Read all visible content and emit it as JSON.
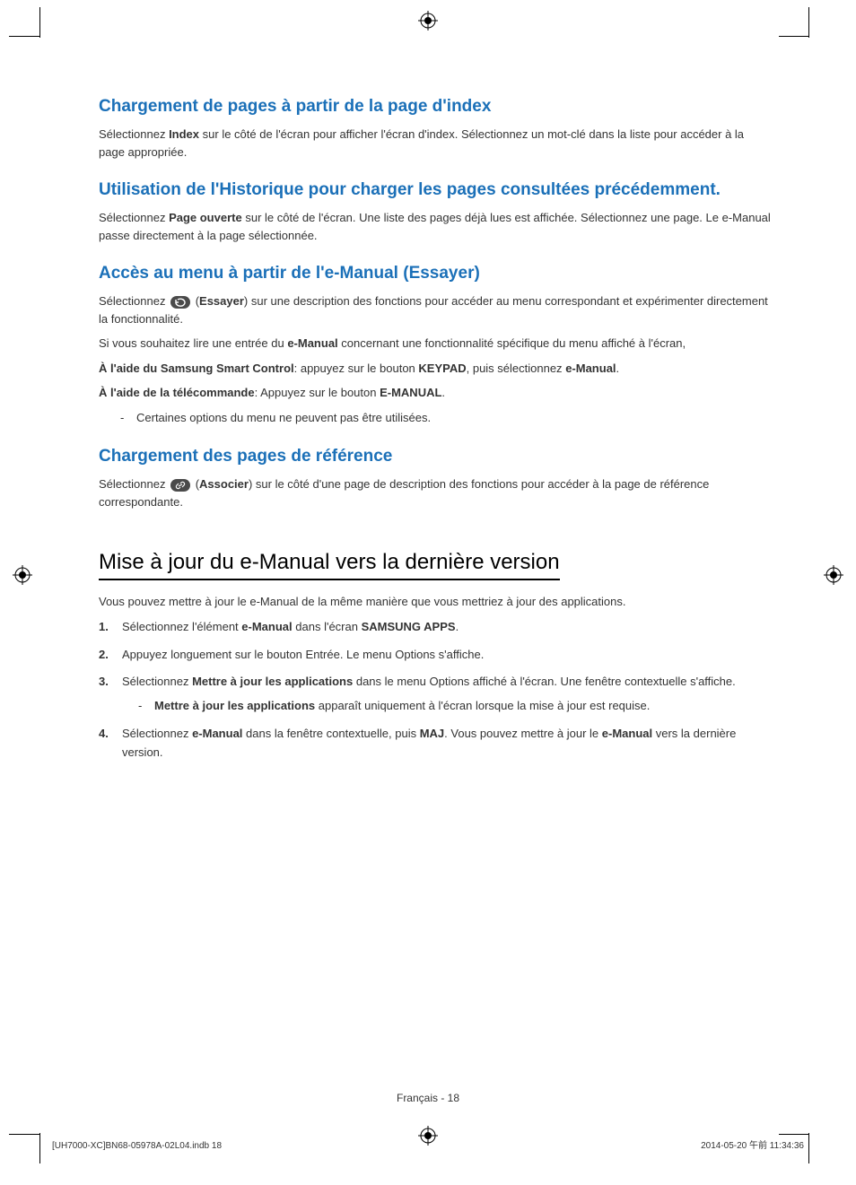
{
  "sections": [
    {
      "title": "Chargement de pages à partir de la page d'index",
      "p1a": "Sélectionnez ",
      "b1": "Index",
      "p1b": " sur le côté de l'écran pour afficher l'écran d'index. Sélectionnez un mot-clé dans la liste pour accéder à la page appropriée."
    },
    {
      "title": "Utilisation de l'Historique pour charger les pages consultées précédemment.",
      "p1a": "Sélectionnez ",
      "b1": "Page ouverte",
      "p1b": " sur le côté de l'écran. Une liste des pages déjà lues est affichée. Sélectionnez une page. Le e-Manual passe directement à la page sélectionnée."
    },
    {
      "title": "Accès au menu à partir de l'e-Manual (Essayer)",
      "p1a": "Sélectionnez ",
      "p1b": " (",
      "b1": "Essayer",
      "p1c": ") sur une description des fonctions pour accéder au menu correspondant et expérimenter directement la fonctionnalité.",
      "p2a": "Si vous souhaitez lire une entrée du ",
      "b2": "e-Manual",
      "p2b": " concernant une fonctionnalité spécifique du menu affiché à l'écran,",
      "b3": "À l'aide du Samsung Smart Control",
      "p3a": ": appuyez sur le bouton ",
      "b3b": "KEYPAD",
      "p3b": ", puis sélectionnez ",
      "b3c": "e-Manual",
      "p3c": ".",
      "b4": "À l'aide de la télécommande",
      "p4a": ": Appuyez sur le bouton ",
      "b4b": "E-MANUAL",
      "p4b": ".",
      "note": "Certaines options du menu ne peuvent pas être utilisées."
    },
    {
      "title": "Chargement des pages de référence",
      "p1a": "Sélectionnez ",
      "p1b": " (",
      "b1": "Associer",
      "p1c": ") sur le côté d'une page de description des fonctions pour accéder à la page de référence correspondante."
    }
  ],
  "major": {
    "title": "Mise à jour du e-Manual vers la dernière version",
    "intro": "Vous pouvez mettre à jour le e-Manual de la même manière que vous mettriez à jour des applications.",
    "steps": [
      {
        "a": "Sélectionnez l'élément ",
        "b1": "e-Manual",
        "c": " dans l'écran ",
        "b2": "SAMSUNG APPS",
        "d": "."
      },
      {
        "a": "Appuyez longuement sur le bouton Entrée. Le menu Options s'affiche."
      },
      {
        "a": "Sélectionnez ",
        "b1": "Mettre à jour les applications",
        "c": " dans le menu Options affiché à l'écran. Une fenêtre contextuelle s'affiche.",
        "sub_b": "Mettre à jour les applications",
        "sub_t": " apparaît uniquement à l'écran lorsque la mise à jour est requise."
      },
      {
        "a": "Sélectionnez ",
        "b1": "e-Manual",
        "c": " dans la fenêtre contextuelle, puis ",
        "b2": "MAJ",
        "d": ". Vous pouvez mettre à jour le ",
        "b3": "e-Manual",
        "e": " vers la dernière version."
      }
    ]
  },
  "footer": {
    "center": "Français - 18",
    "left": "[UH7000-XC]BN68-05978A-02L04.indb   18",
    "right": "2014-05-20   午前 11:34:36"
  }
}
